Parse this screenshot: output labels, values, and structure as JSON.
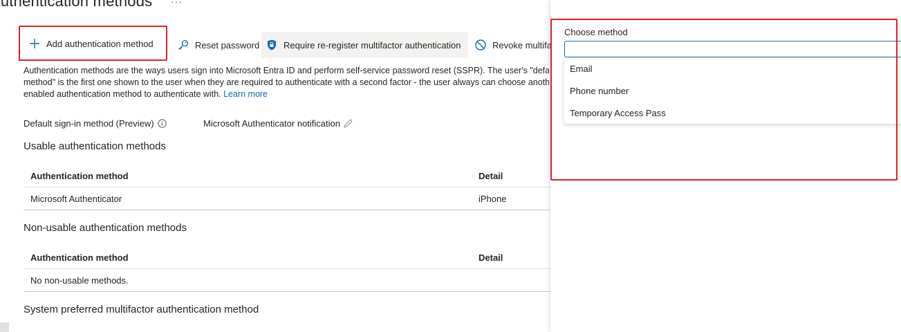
{
  "page": {
    "title": "Authentication methods",
    "more": "···"
  },
  "toolbar": {
    "add_label": "Add authentication method",
    "reset_label": "Reset password",
    "require_label": "Require re-register multifactor authentication",
    "revoke_label": "Revoke multifactor authentication sessions"
  },
  "description": {
    "line1": "Authentication methods are the ways users sign into Microsoft Entra ID and perform self-service password reset (SSPR). The user's \"default sign-in",
    "line2": "method\" is the first one shown to the user when they are required to authenticate with a second factor - the user always can choose another",
    "line3": "enabled authentication method to authenticate with.",
    "learn_more": "Learn more"
  },
  "default_method": {
    "label": "Default sign-in method (Preview)",
    "value": "Microsoft Authenticator notification"
  },
  "usable": {
    "title": "Usable authentication methods",
    "headers": [
      "Authentication method",
      "Detail"
    ],
    "rows": [
      [
        "Microsoft Authenticator",
        "iPhone"
      ]
    ]
  },
  "non_usable": {
    "title": "Non-usable authentication methods",
    "headers": [
      "Authentication method",
      "Detail"
    ],
    "empty_text": "No non-usable methods."
  },
  "system_preferred": {
    "title": "System preferred multifactor authentication method"
  },
  "panel": {
    "choose_label": "Choose method",
    "input_value": "",
    "options": [
      "Email",
      "Phone number",
      "Temporary Access Pass"
    ]
  },
  "colors": {
    "accent": "#0f6cbd",
    "highlight": "#e0201e",
    "text": "#242424"
  }
}
